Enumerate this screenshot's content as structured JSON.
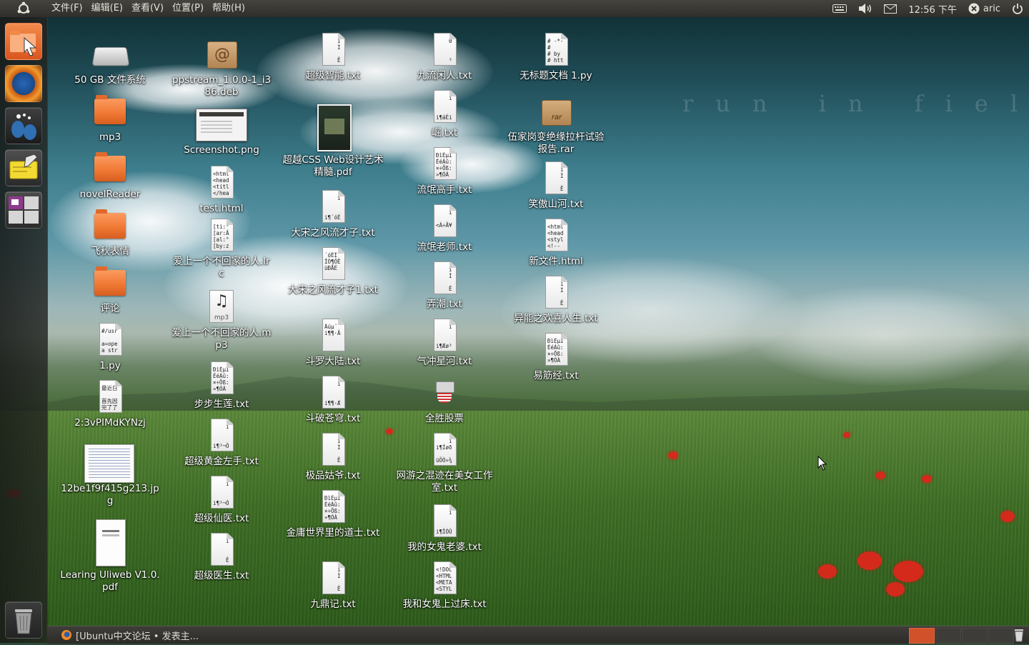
{
  "top_panel": {
    "menus": [
      "文件(F)",
      "编辑(E)",
      "查看(V)",
      "位置(P)",
      "帮助(H)"
    ],
    "clock": "12:56 下午",
    "user": "aric",
    "icons": [
      "keyboard-icon",
      "volume-icon",
      "mail-icon",
      "user-icon",
      "power-icon"
    ]
  },
  "launcher": {
    "items": [
      "files-icon",
      "firefox-icon",
      "gimp-icon",
      "notes-icon",
      "workspace-switcher-icon",
      "trash-icon"
    ]
  },
  "wallpaper": {
    "tagline": "run in fields"
  },
  "desktop": {
    "col1": [
      {
        "label": "50 GB 文件系统",
        "type": "drive"
      },
      {
        "label": "mp3",
        "type": "folder"
      },
      {
        "label": "novelReader",
        "type": "folder"
      },
      {
        "label": "飞秋表情",
        "type": "folder"
      },
      {
        "label": "评论",
        "type": "folder"
      },
      {
        "label": "1.py",
        "type": "doc",
        "snippet": "#/usr\n\na=ope\na str"
      },
      {
        "label": "2:3vPIMdKYNzj",
        "type": "doc",
        "snippet": "最近日\n\n首先因\n完了了"
      },
      {
        "label": "12be1f9f415g213.jpg",
        "type": "jpg"
      },
      {
        "label": "Learing Uliweb V1.0.pdf",
        "type": "pdfpage"
      }
    ],
    "col2": [
      {
        "label": "ppstream_1.0.0-1_i386.deb",
        "type": "pkg"
      },
      {
        "label": "Screenshot.png",
        "type": "shot"
      },
      {
        "label": "test.html",
        "type": "doc",
        "snippet": "<html\n<head\n<titl\n</hea"
      },
      {
        "label": "爱上一个不回家的人.lrc",
        "type": "doc",
        "snippet": "[ti:°\n[ar:Â\n[al:°\n[by:z"
      },
      {
        "label": "爱上一个不回家的人.mp3",
        "type": "audio"
      },
      {
        "label": "步步生莲.txt",
        "type": "doc",
        "snippet": "ÐìÈµÏ\nÉéÁû:\n×÷Õß:\n»¶ÓÀ"
      },
      {
        "label": "超级黄金左手.txt",
        "type": "doc",
        "snippet": "    i\n\n\ni¶³¬Ò"
      },
      {
        "label": "超级仙医.txt",
        "type": "doc",
        "snippet": "    i\n\n\ni¶³¬Ò"
      },
      {
        "label": "超级医生.txt",
        "type": "doc",
        "snippet": "    i\n\n\n    Ê"
      }
    ],
    "col3": [
      {
        "label": "超级智能.txt",
        "type": "doc",
        "snippet": "    i\n    Ì\n\n    Ê"
      },
      {
        "label": "超越CSS Web设计艺术精髓.pdf",
        "type": "book"
      },
      {
        "label": "大宋之风流才子.txt",
        "type": "doc",
        "snippet": "    i\n\n\ni¶´óÉ"
      },
      {
        "label": "大宋之风流才子1.txt",
        "type": "doc",
        "snippet": "´óËÎ\nÎÒ¶ÔË\nüÐÅÉ"
      },
      {
        "label": "斗罗大陆.txt",
        "type": "doc",
        "snippet": "Äúµ´\ni¶¶·Â"
      },
      {
        "label": "斗破苍穹.txt",
        "type": "doc",
        "snippet": "    i\n\n\ni¶¶·Æ"
      },
      {
        "label": "极品姑爷.txt",
        "type": "doc",
        "snippet": "    i\n    Ì\n\n    Ê"
      },
      {
        "label": "金庸世界里的道士.txt",
        "type": "doc",
        "snippet": "ÐìÈµÏ\nÉéÁû:\n×÷Õß:\n»¶ÓÀ"
      },
      {
        "label": "九鼎记.txt",
        "type": "doc",
        "snippet": "    i\n    Ì\n\n    Ê"
      }
    ],
    "col4": [
      {
        "label": "九流闲人.txt",
        "type": "doc",
        "snippet": "    0\n\n\n    ³"
      },
      {
        "label": "崛.txt",
        "type": "doc",
        "snippet": "    i\n\n\ni¶áÉi"
      },
      {
        "label": "流氓高手.txt",
        "type": "doc",
        "snippet": "ÐìÈµÏ\nÉéÁû:\n×÷Õß:\n»¶ÓÀ"
      },
      {
        "label": "流氓老师.txt",
        "type": "doc",
        "snippet": "    i\n\n<Á÷Ã¥"
      },
      {
        "label": "弄潮.txt",
        "type": "doc",
        "snippet": "    i\n    Ì\n\n    Ê"
      },
      {
        "label": "气冲星河.txt",
        "type": "doc",
        "snippet": "    i\n\n\ni¶Æø³"
      },
      {
        "label": "全胜股票",
        "type": "exec"
      },
      {
        "label": "网游之混迹在美女工作室.txt",
        "type": "doc",
        "snippet": "    i\ni¶Íøð\n\nüÖÒ»¾"
      },
      {
        "label": "我的女鬼老婆.txt",
        "type": "doc",
        "snippet": "    i\n\n\ni¶ÎÒÛ"
      },
      {
        "label": "我和女鬼上过床.txt",
        "type": "doc",
        "snippet": "<!DOC\n<HTML\n<META\n<STYL"
      }
    ],
    "col5": [
      {
        "label": "无标题文档 1.py",
        "type": "doc",
        "snippet": "# -*-\n#\n# by\n# htt"
      },
      {
        "label": "伍家岗变绝缘拉杆试验报告.rar",
        "type": "archive"
      },
      {
        "label": "笑傲山河.txt",
        "type": "doc",
        "snippet": "    i\n    Ì\n\n    Ê"
      },
      {
        "label": "新文件.html",
        "type": "doc",
        "snippet": "<html\n<head\n<styl\n<!--"
      },
      {
        "label": "异能之欢喜人生.txt",
        "type": "doc",
        "snippet": "    i\n    Ì\n\n    Ê"
      },
      {
        "label": "易筋经.txt",
        "type": "doc",
        "snippet": "ÐìÈµÏ\nÉéÁû:\n×÷Õß:\n»¶ÓÀ"
      }
    ]
  },
  "bottom_panel": {
    "task": "[Ubuntu中文论坛 • 发表主...",
    "workspaces": 4,
    "active_workspace": 1
  }
}
